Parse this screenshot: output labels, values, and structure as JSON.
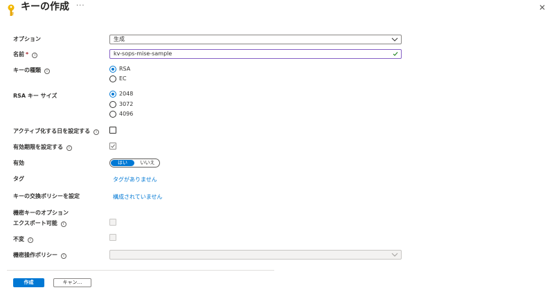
{
  "header": {
    "title": "キーの作成",
    "more": "···",
    "close_icon": "close-icon",
    "key_icon": "key-icon"
  },
  "form": {
    "option": {
      "label": "オプション",
      "value": "生成"
    },
    "name": {
      "label": "名前",
      "required_mark": "*",
      "value": "kv-sops-mise-sample"
    },
    "key_type": {
      "label": "キーの種類",
      "options": [
        "RSA",
        "EC"
      ],
      "selected": "RSA"
    },
    "rsa_size": {
      "label": "RSA キー サイズ",
      "options": [
        "2048",
        "3072",
        "4096"
      ],
      "selected": "2048"
    },
    "activation": {
      "label": "アクティブ化する日を設定する",
      "checked": false
    },
    "expiration": {
      "label": "有効期限を設定する",
      "checked": true
    },
    "enabled": {
      "label": "有効",
      "yes": "はい",
      "no": "いいえ",
      "selected": "はい"
    },
    "tags": {
      "label": "タグ",
      "link": "タグがありません"
    },
    "rotation": {
      "label": "キーの交換ポリシーを設定",
      "link": "構成されていません"
    },
    "confidential": {
      "section_label": "機密キーのオプション",
      "exportable": {
        "label": "エクスポート可能",
        "checked": false
      },
      "immutable": {
        "label": "不変",
        "checked": false
      },
      "policy": {
        "label": "機密操作ポリシー",
        "value": ""
      }
    }
  },
  "footer": {
    "create_label": "作成",
    "cancel_label": "キャン…"
  },
  "colors": {
    "accent": "#0078d4",
    "key_icon": "#f2b700",
    "focus_border": "#8661c5",
    "required": "#a4262c"
  }
}
